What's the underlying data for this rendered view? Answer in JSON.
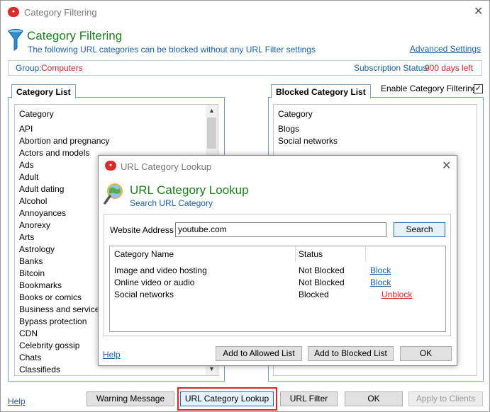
{
  "window": {
    "title": "Category Filtering",
    "heading": "Category Filtering",
    "subheading": "The following URL categories can be blocked without any URL Filter settings",
    "advanced_link": "Advanced Settings"
  },
  "info": {
    "group_label": "Group:",
    "group_value": "Computers",
    "subscription_label": "Subscription Status:",
    "subscription_value": "900 days left"
  },
  "category_list": {
    "tab_label": "Category List",
    "header": "Category",
    "items": [
      "API",
      "Abortion and pregnancy",
      "Actors and models",
      "Ads",
      "Adult",
      "Adult dating",
      "Alcohol",
      "Annoyances",
      "Anorexy",
      "Arts",
      "Astrology",
      "Banks",
      "Bitcoin",
      "Bookmarks",
      "Books or comics",
      "Business and services",
      "Bypass protection",
      "CDN",
      "Celebrity gossip",
      "Chats",
      "Classifieds"
    ]
  },
  "blocked_list": {
    "tab_label": "Blocked Category List",
    "enable_label": "Enable Category Filtering",
    "enable_checked": true,
    "header": "Category",
    "items": [
      "Blogs",
      "Social networks"
    ]
  },
  "footer": {
    "help": "Help",
    "warning_btn": "Warning Message",
    "lookup_btn": "URL Category Lookup",
    "url_filter_btn": "URL Filter",
    "ok_btn": "OK",
    "apply_btn": "Apply to Clients"
  },
  "dialog": {
    "title": "URL Category Lookup",
    "heading": "URL Category Lookup",
    "subheading": "Search URL Category",
    "address_label": "Website Address",
    "address_value": "youtube.com",
    "search_btn": "Search",
    "columns": [
      "Category Name",
      "Status",
      ""
    ],
    "rows": [
      {
        "name": "Image and video hosting",
        "status": "Not Blocked",
        "action": "Block"
      },
      {
        "name": "Online video or audio",
        "status": "Not Blocked",
        "action": "Block"
      },
      {
        "name": "Social networks",
        "status": "Blocked",
        "action": "Unblock"
      }
    ],
    "help": "Help",
    "add_allowed_btn": "Add to Allowed List",
    "add_blocked_btn": "Add to Blocked List",
    "ok_btn": "OK"
  },
  "colors": {
    "heading_green": "#1e7e1e",
    "link_blue": "#1a5fa8",
    "value_red": "#c0282d",
    "highlight_red": "#d8262a"
  }
}
